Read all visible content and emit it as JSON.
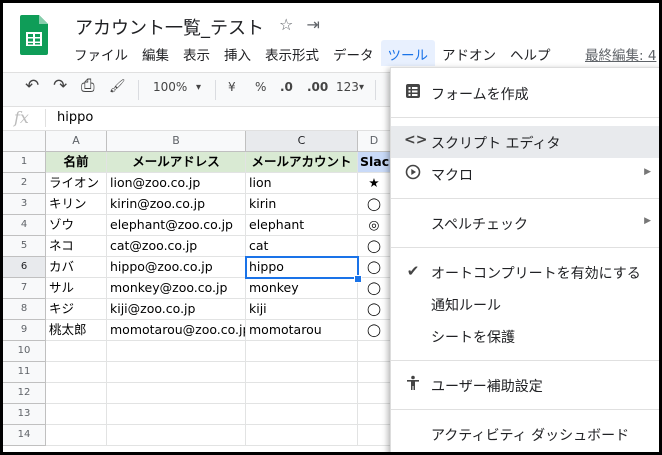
{
  "doc": {
    "title": "アカウント一覧_テスト",
    "star_glyph": "☆",
    "move_glyph": "⇥"
  },
  "menubar": {
    "items": [
      "ファイル",
      "編集",
      "表示",
      "挿入",
      "表示形式",
      "データ",
      "ツール",
      "アドオン",
      "ヘルプ"
    ],
    "active_index": 6,
    "last_edit": "最終編集: 4"
  },
  "toolbar": {
    "undo": "↶",
    "redo": "↷",
    "print": "⎙",
    "paint": "🖌",
    "zoom": "100%",
    "zoom_caret": "▾",
    "currency": "¥",
    "percent": "%",
    "decrease_decimal": ".0",
    "increase_decimal": ".00",
    "format": "123",
    "format_caret": "▾"
  },
  "formula_bar": {
    "fx": "fx",
    "value": "hippo"
  },
  "grid": {
    "columns": [
      "A",
      "B",
      "C",
      "D"
    ],
    "rows": [
      "1",
      "2",
      "3",
      "4",
      "5",
      "6",
      "7",
      "8",
      "9",
      "10",
      "11",
      "12",
      "13",
      "14"
    ],
    "header": [
      "名前",
      "メールアドレス",
      "メールアカウント",
      "Slack"
    ],
    "data": [
      [
        "ライオン",
        "lion@zoo.co.jp",
        "lion",
        "★"
      ],
      [
        "キリン",
        "kirin@zoo.co.jp",
        "kirin",
        "◯"
      ],
      [
        "ゾウ",
        "elephant@zoo.co.jp",
        "elephant",
        "◎"
      ],
      [
        "ネコ",
        "cat@zoo.co.jp",
        "cat",
        "◯"
      ],
      [
        "カバ",
        "hippo@zoo.co.jp",
        "hippo",
        "◯"
      ],
      [
        "サル",
        "monkey@zoo.co.jp",
        "monkey",
        "◯"
      ],
      [
        "キジ",
        "kiji@zoo.co.jp",
        "kiji",
        "◯"
      ],
      [
        "桃太郎",
        "momotarou@zoo.co.jp",
        "momotarou",
        "◯"
      ]
    ],
    "selected": {
      "row": 6,
      "col": "C"
    }
  },
  "tools_menu": {
    "items": [
      {
        "label": "フォームを作成",
        "icon": "form-icon",
        "glyph": "▤"
      },
      {
        "label": "スクリプト エディタ",
        "icon": "code-icon",
        "glyph": "<>"
      },
      {
        "label": "マクロ",
        "icon": "macro-icon",
        "glyph": "▶",
        "arrow": "▶"
      },
      {
        "label": "スペルチェック",
        "icon": "",
        "glyph": "",
        "arrow": "▶"
      },
      {
        "label": "オートコンプリートを有効にする",
        "icon": "check-icon",
        "glyph": "✔"
      },
      {
        "label": "通知ルール",
        "icon": "",
        "glyph": ""
      },
      {
        "label": "シートを保護",
        "icon": "",
        "glyph": ""
      },
      {
        "label": "ユーザー補助設定",
        "icon": "accessibility-icon",
        "glyph": "🚶"
      },
      {
        "label": "アクティビティ ダッシュボード",
        "icon": "",
        "glyph": ""
      }
    ],
    "highlighted_index": 1
  }
}
